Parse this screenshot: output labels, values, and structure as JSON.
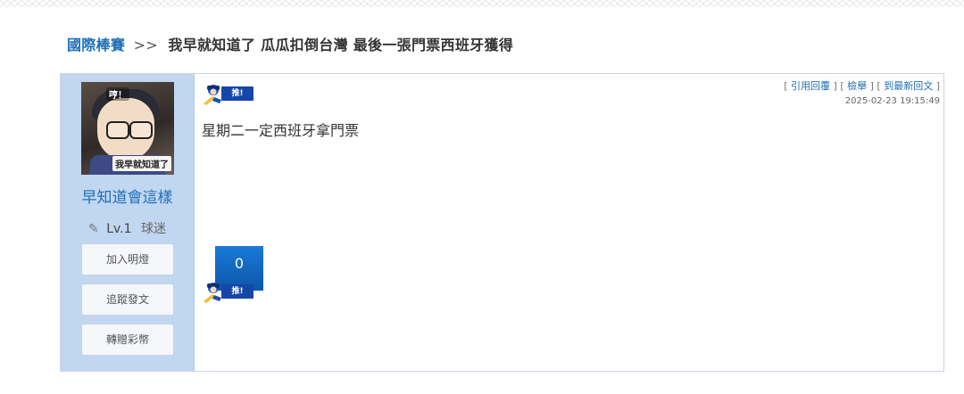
{
  "breadcrumb": {
    "category": "國際棒賽",
    "separator": ">>",
    "title": "我早就知道了 瓜瓜扣倒台灣 最後一張門票西班牙獲得"
  },
  "author": {
    "avatar_bubble": "哼！",
    "avatar_caption": "我早就知道了",
    "username": "早知道會這樣",
    "level": "Lv.1",
    "rank": "球迷",
    "buttons": [
      "加入明燈",
      "追蹤發文",
      "轉贈彩幣"
    ]
  },
  "post": {
    "push_tag": "推!",
    "content": "星期二一定西班牙拿門票",
    "actions": [
      "引用回覆",
      "檢舉",
      "到最新回文"
    ],
    "timestamp": "2025-02-23 19:15:49",
    "push_count": "0"
  },
  "colors": {
    "link": "#1f6fb8",
    "sidebar_bg": "#c1d6f0",
    "push_blue": "#0c56a8"
  },
  "icons": {
    "push": "baseball-player-push-icon",
    "level": "pencil-icon"
  }
}
